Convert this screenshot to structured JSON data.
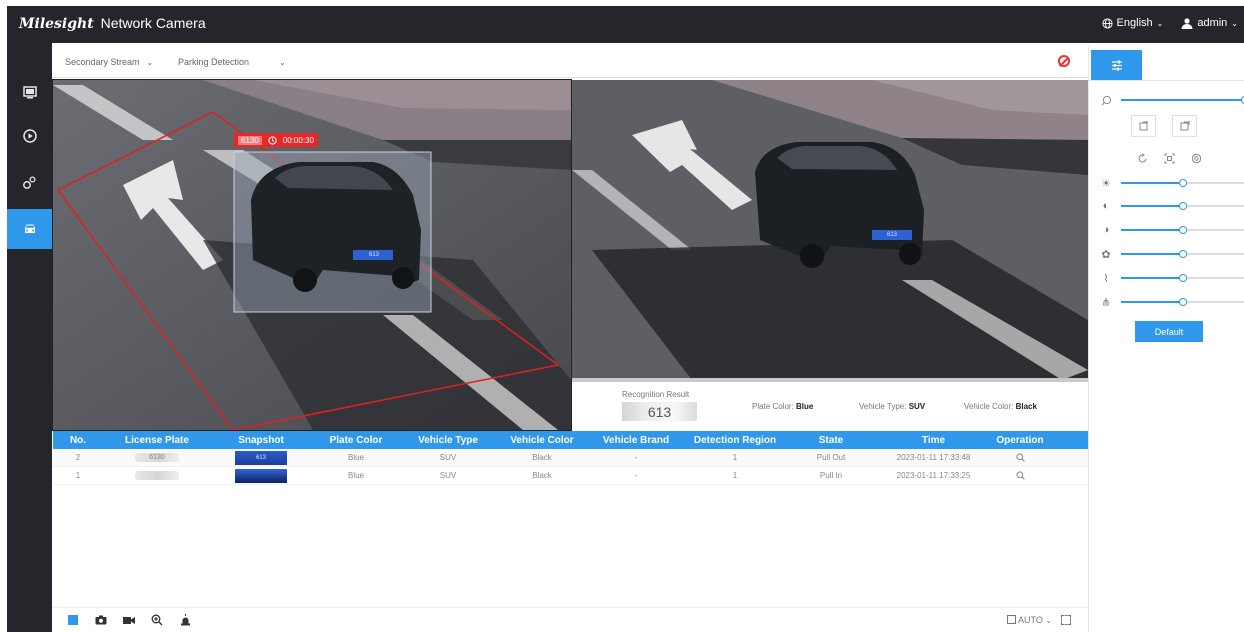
{
  "header": {
    "brand_logo": "Milesight",
    "product": "Network Camera",
    "language": "English",
    "user": "admin"
  },
  "sidebar": {
    "items": [
      {
        "name": "live-view",
        "icon": "monitor-icon"
      },
      {
        "name": "playback",
        "icon": "play-circle-icon"
      },
      {
        "name": "settings",
        "icon": "gears-icon"
      },
      {
        "name": "vehicle",
        "icon": "car-icon",
        "active": true
      }
    ]
  },
  "stream": {
    "stream_select": "Secondary Stream",
    "mode_select": "Parking Detection"
  },
  "overlay": {
    "plate_tag": "6130",
    "timer": "00:00:30",
    "snapshot_plate": "613"
  },
  "recognition": {
    "title": "Recognition Result",
    "plate": "613",
    "plate_color_label": "Plate Color:",
    "plate_color": "Blue",
    "vehicle_type_label": "Vehicle Type:",
    "vehicle_type": "SUV",
    "vehicle_color_label": "Vehicle Color:",
    "vehicle_color": "Black"
  },
  "table": {
    "columns": [
      "No.",
      "License Plate",
      "Snapshot",
      "Plate Color",
      "Vehicle Type",
      "Vehicle Color",
      "Vehicle Brand",
      "Detection Region",
      "State",
      "Time",
      "Operation"
    ],
    "rows": [
      {
        "no": "2",
        "plate": "6130",
        "snapshot": "613",
        "plate_color": "Blue",
        "type": "SUV",
        "color": "Black",
        "brand": "-",
        "region": "1",
        "state": "Pull Out",
        "time": "2023-01-11 17:33:48"
      },
      {
        "no": "1",
        "plate": "",
        "snapshot": "",
        "plate_color": "Blue",
        "type": "SUV",
        "color": "Black",
        "brand": "-",
        "region": "1",
        "state": "Pull In",
        "time": "2023-01-11 17:33:25"
      }
    ]
  },
  "bottom": {
    "auto_label": "AUTO"
  },
  "panel": {
    "zoom": 1.0,
    "brightness": 0.5,
    "contrast": 0.5,
    "saturation": 0.5,
    "hue": 0.5,
    "sharpness": 0.5,
    "noise_reduction": 0.5,
    "default_label": "Default"
  },
  "colors": {
    "accent": "#2f98ea",
    "header_bg": "#24262b",
    "detection_region": "#e02020"
  }
}
